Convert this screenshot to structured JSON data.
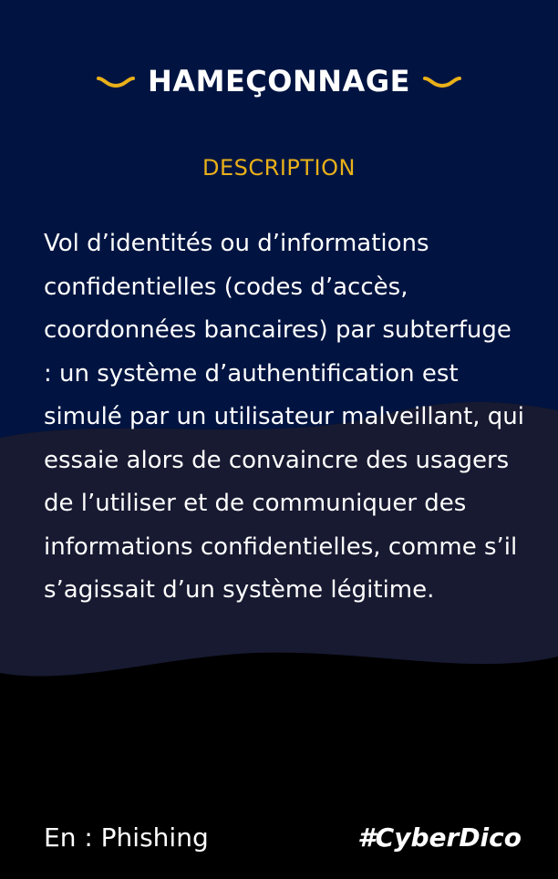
{
  "card": {
    "title": "HAMEÇONNAGE",
    "section_label": "DESCRIPTION",
    "description": "Vol d’identités ou d’informations confidentielles (codes d’accès, coordonnées bancaires) par subterfuge : un système d’authentification est simulé par un utilisateur malveillant, qui essaie alors de convaincre des usagers de l’utiliser et de communiquer des informations confidentielles, comme s’il s’agissait d’un système légitime.",
    "english_term": "En : Phishing",
    "hashtag": "#CyberDico"
  },
  "icons": {
    "left_ornament": "squiggle-icon",
    "right_ornament": "squiggle-icon"
  },
  "colors": {
    "top_background": "#011441",
    "middle_band": "#171a31",
    "bottom_background": "#000000",
    "accent": "#e9b019",
    "text": "#ffffff"
  }
}
